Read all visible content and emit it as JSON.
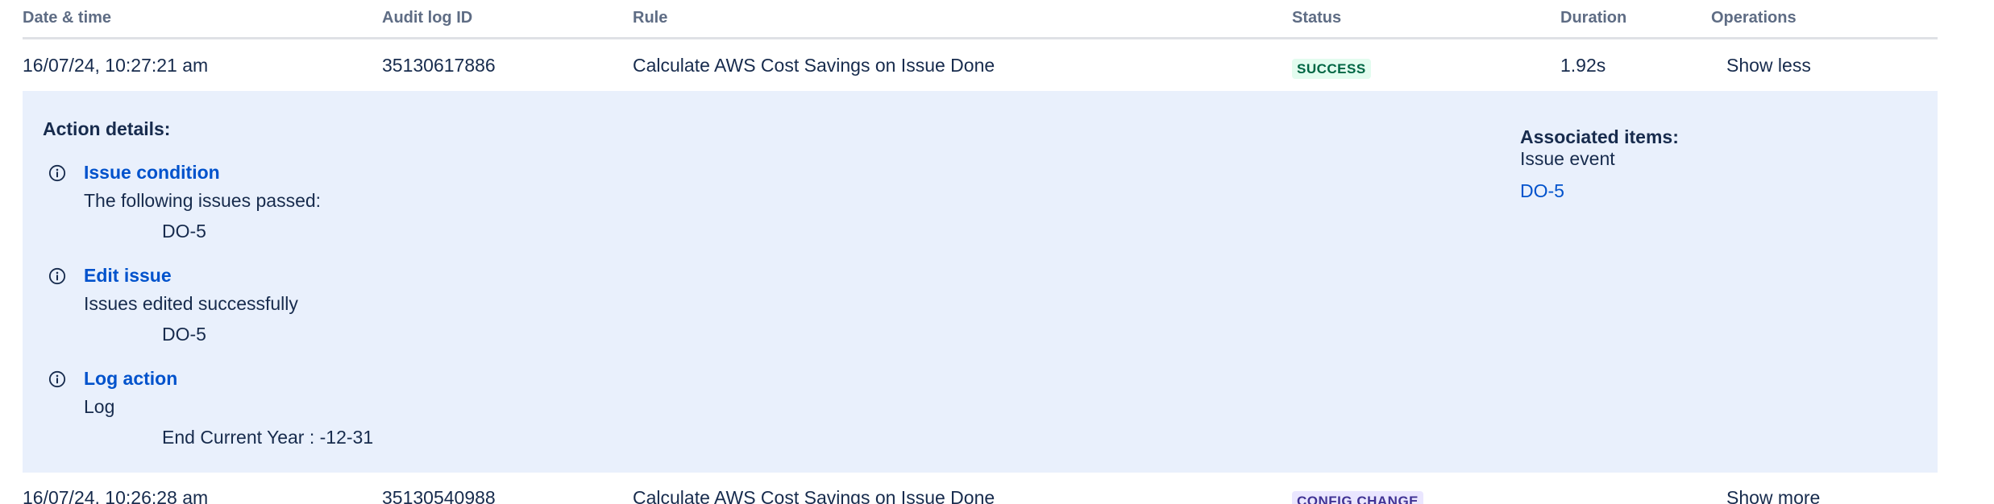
{
  "table": {
    "columns": [
      "Date & time",
      "Audit log ID",
      "Rule",
      "Status",
      "Duration",
      "Operations"
    ],
    "rows": [
      {
        "datetime": "16/07/24, 10:27:21 am",
        "audit_id": "35130617886",
        "rule": "Calculate AWS Cost Savings on Issue Done",
        "status": "SUCCESS",
        "duration": "1.92s",
        "operation": "Show less"
      },
      {
        "datetime": "16/07/24, 10:26:28 am",
        "audit_id": "35130540988",
        "rule": "Calculate AWS Cost Savings on Issue Done",
        "status": "CONFIG CHANGE",
        "duration": "",
        "operation": "Show more"
      }
    ]
  },
  "details": {
    "title": "Action details:",
    "actions": [
      {
        "icon": "info-icon",
        "name": "Issue condition",
        "description": "The following issues passed:",
        "item": "DO-5"
      },
      {
        "icon": "info-icon",
        "name": "Edit issue",
        "description": "Issues edited successfully",
        "item": "DO-5"
      },
      {
        "icon": "info-icon",
        "name": "Log action",
        "description": "Log",
        "item": "End Current Year : -12-31"
      }
    ],
    "associated": {
      "title": "Associated items:",
      "label": "Issue event",
      "link": "DO-5"
    }
  },
  "colors": {
    "success_bg": "#e3fcef",
    "success_text": "#006644",
    "config_bg": "#eae6ff",
    "config_text": "#403294",
    "link": "#0052cc",
    "details_bg": "#e9f0fc"
  }
}
